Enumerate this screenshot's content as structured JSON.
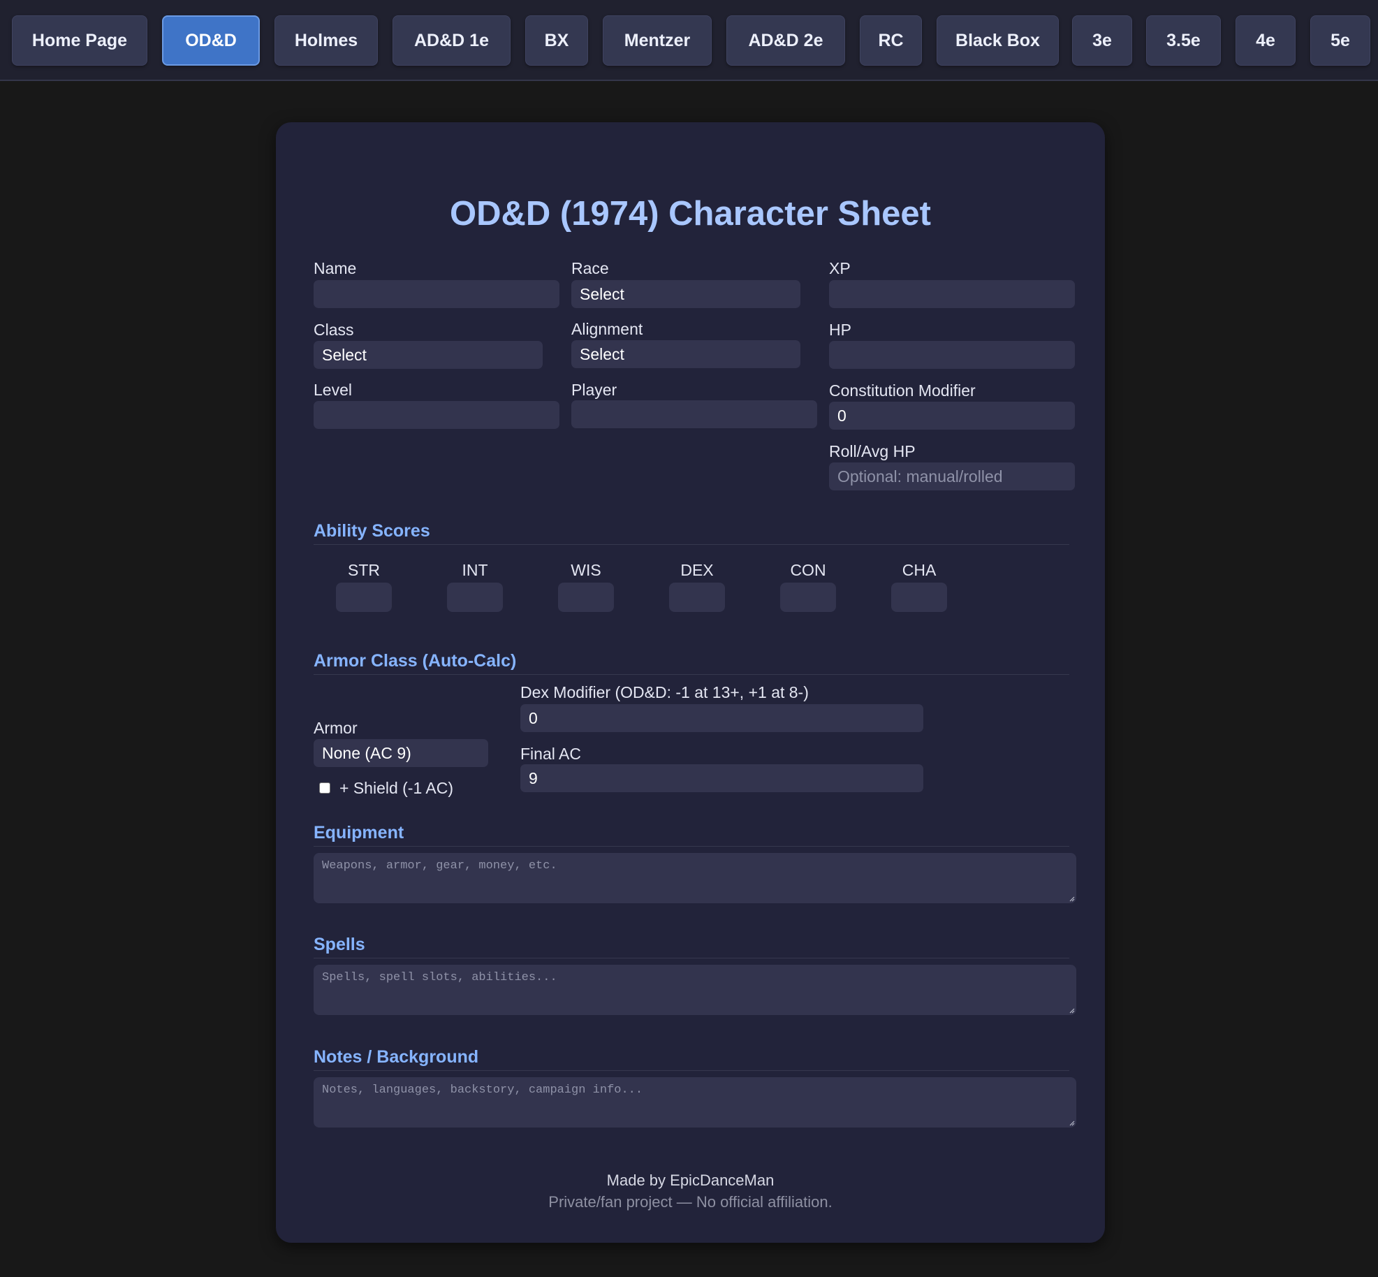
{
  "nav": {
    "items": [
      {
        "label": "Home Page",
        "active": false
      },
      {
        "label": "OD&D",
        "active": true
      },
      {
        "label": "Holmes",
        "active": false
      },
      {
        "label": "AD&D 1e",
        "active": false
      },
      {
        "label": "BX",
        "active": false
      },
      {
        "label": "Mentzer",
        "active": false
      },
      {
        "label": "AD&D 2e",
        "active": false
      },
      {
        "label": "RC",
        "active": false
      },
      {
        "label": "Black Box",
        "active": false
      },
      {
        "label": "3e",
        "active": false
      },
      {
        "label": "3.5e",
        "active": false
      },
      {
        "label": "4e",
        "active": false
      },
      {
        "label": "5e",
        "active": false
      }
    ]
  },
  "sheet": {
    "title": "OD&D (1974) Character Sheet",
    "fields": {
      "name": {
        "label": "Name",
        "value": ""
      },
      "race": {
        "label": "Race",
        "value": "Select"
      },
      "xp": {
        "label": "XP",
        "value": ""
      },
      "class": {
        "label": "Class",
        "value": "Select"
      },
      "alignment": {
        "label": "Alignment",
        "value": "Select"
      },
      "hp": {
        "label": "HP",
        "value": ""
      },
      "level": {
        "label": "Level",
        "value": ""
      },
      "player": {
        "label": "Player",
        "value": ""
      },
      "con_mod": {
        "label": "Constitution Modifier",
        "value": "0"
      },
      "roll_hp": {
        "label": "Roll/Avg HP",
        "value": "",
        "placeholder": "Optional: manual/rolled"
      }
    },
    "ability_section": {
      "title": "Ability Scores",
      "abilities": [
        {
          "label": "STR",
          "value": ""
        },
        {
          "label": "INT",
          "value": ""
        },
        {
          "label": "WIS",
          "value": ""
        },
        {
          "label": "DEX",
          "value": ""
        },
        {
          "label": "CON",
          "value": ""
        },
        {
          "label": "CHA",
          "value": ""
        }
      ]
    },
    "armor_section": {
      "title": "Armor Class (Auto-Calc)",
      "armor_label": "Armor",
      "armor_value": "None (AC 9)",
      "shield_label": "+ Shield (-1 AC)",
      "shield_checked": false,
      "dex_label": "Dex Modifier (OD&D: -1 at 13+, +1 at 8-)",
      "dex_value": "0",
      "final_label": "Final AC",
      "final_value": "9"
    },
    "equipment": {
      "title": "Equipment",
      "placeholder": "Weapons, armor, gear, money, etc."
    },
    "spells": {
      "title": "Spells",
      "placeholder": "Spells, spell slots, abilities..."
    },
    "notes": {
      "title": "Notes / Background",
      "placeholder": "Notes, languages, backstory, campaign info..."
    }
  },
  "footer": {
    "credit": "Made by EpicDanceMan",
    "disclaimer": "Private/fan project — No official affiliation."
  },
  "colors": {
    "page_bg": "#181818",
    "nav_bg": "#20212f",
    "button": "#343851",
    "active_button": "#3f74c7",
    "card": "#22233a",
    "input": "#33344e",
    "title": "#a9c7ff",
    "section_heading": "#86b4ff"
  }
}
